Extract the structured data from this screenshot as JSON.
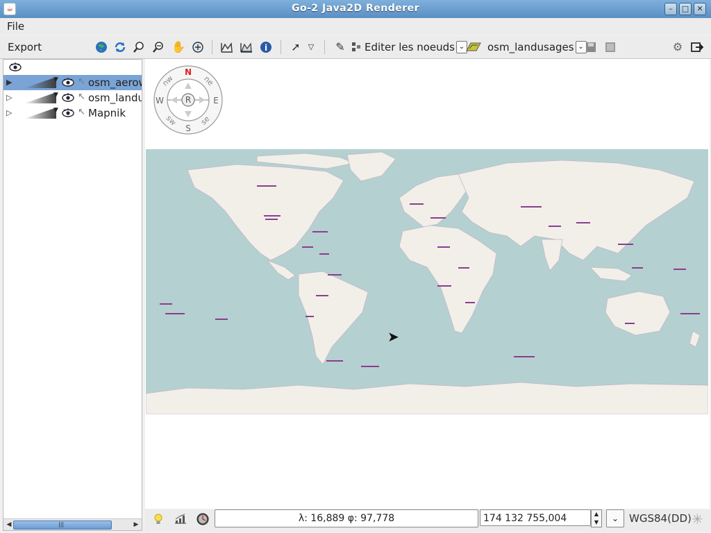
{
  "window": {
    "title": "Go-2 Java2D Renderer",
    "app_icon": "java-icon",
    "minimize": "–",
    "maximize": "□",
    "close": "✕"
  },
  "menu": {
    "file": "File"
  },
  "toolbar": {
    "export_label": "Export",
    "edit_nodes_label": "Editer les noeuds",
    "layer_label": "osm_landusages",
    "icons": [
      "globe-icon",
      "refresh-icon",
      "zoom-in-icon",
      "zoom-out-icon",
      "pan-hand-icon",
      "zoom-extent-icon",
      "chart-icon",
      "chart-fill-icon",
      "info-icon",
      "select-arrow-icon",
      "dropdown-icon",
      "pencil-icon",
      "nodes-icon",
      "layer-icon",
      "save-icon",
      "save-as-icon",
      "settings-icon",
      "exit-icon"
    ]
  },
  "layers": [
    {
      "name": "osm_aerow",
      "selected": true
    },
    {
      "name": "osm_landu",
      "selected": false
    },
    {
      "name": "Mapnik",
      "selected": false
    }
  ],
  "compass": {
    "n": "N",
    "s": "S",
    "e": "E",
    "w": "W",
    "ne": "ne",
    "nw": "nw",
    "se": "se",
    "sw": "sw",
    "center": "R"
  },
  "status": {
    "coords": "λ: 16,889   φ: 97,778",
    "scale": "174 132 755,004",
    "crs": "WGS84(DD)"
  },
  "colors": {
    "titlebar": "#6a9fd2",
    "selection": "#7aa3d6",
    "ocean": "#b5d0d0",
    "land": "#f2efe9",
    "label": "#8a3d8f"
  }
}
